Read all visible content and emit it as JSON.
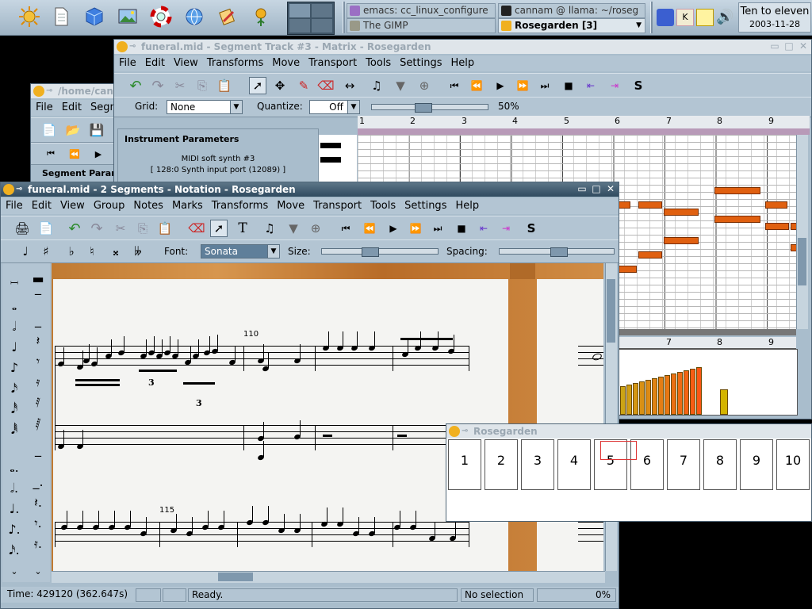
{
  "panel": {
    "tasks": [
      {
        "label": "emacs: cc_linux_configure",
        "active": false
      },
      {
        "label": "cannam @ llama:  ~/roseg",
        "active": false
      },
      {
        "label": "The GIMP",
        "active": false
      },
      {
        "label": "Rosegarden [3]",
        "active": true
      }
    ],
    "clock_title": "Ten to eleven",
    "clock_date": "2003-11-28"
  },
  "bg_window": {
    "title": "/home/can",
    "menu": [
      "File",
      "Edit",
      "Segme"
    ],
    "label": "Segment Param"
  },
  "matrix": {
    "title": "funeral.mid - Segment Track #3 - Matrix - Rosegarden",
    "menu": [
      "File",
      "Edit",
      "View",
      "Transforms",
      "Move",
      "Transport",
      "Tools",
      "Settings",
      "Help"
    ],
    "grid_label": "Grid:",
    "grid_value": "None",
    "quantize_label": "Quantize:",
    "quantize_value": "Off",
    "zoom": "50%",
    "instrument_heading": "Instrument Parameters",
    "instrument_name": "MIDI soft synth #3",
    "instrument_port": "[ 128:0 Synth input port (12089) ]",
    "ruler_bars": [
      "1",
      "2",
      "3",
      "4",
      "5",
      "6",
      "7",
      "8",
      "9"
    ],
    "lower_ruler_bars": [
      "7",
      "8",
      "9"
    ]
  },
  "notation": {
    "title": "funeral.mid - 2 Segments - Notation - Rosegarden",
    "menu": [
      "File",
      "Edit",
      "View",
      "Group",
      "Notes",
      "Marks",
      "Transforms",
      "Move",
      "Transport",
      "Tools",
      "Settings",
      "Help"
    ],
    "font_label": "Font:",
    "font_value": "Sonata",
    "size_label": "Size:",
    "spacing_label": "Spacing:",
    "bar_number_1": "110",
    "bar_number_2": "115",
    "triplet_1": "3",
    "triplet_2": "3",
    "status": {
      "time": "Time: 429120 (362.647s)",
      "message": "Ready.",
      "selection": "No selection",
      "percent": "0%"
    }
  },
  "track_window": {
    "title": "Rosegarden",
    "tracks": [
      "1",
      "2",
      "3",
      "4",
      "5",
      "6",
      "7",
      "8",
      "9",
      "10"
    ]
  },
  "colors": {
    "note": "#e06010",
    "titlebar_active": "#2f4a5f",
    "window_bg": "#a9bdcc",
    "wood": "#c07a32"
  }
}
